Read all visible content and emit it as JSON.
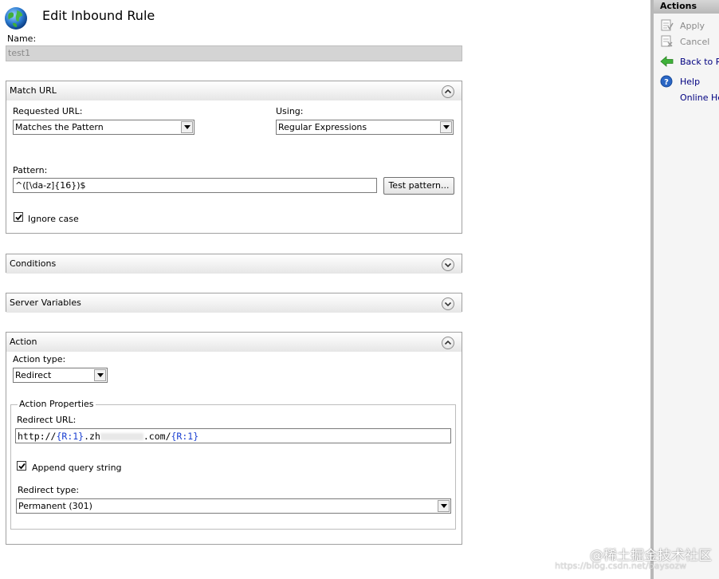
{
  "page": {
    "title": "Edit Inbound Rule",
    "name_label": "Name:",
    "name_value": "test1"
  },
  "match_url": {
    "title": "Match URL",
    "requested_url_label": "Requested URL:",
    "requested_url_value": "Matches the Pattern",
    "using_label": "Using:",
    "using_value": "Regular Expressions",
    "pattern_label": "Pattern:",
    "pattern_value": "^([\\da-z]{16})$",
    "test_pattern_button": "Test pattern...",
    "ignore_case_label": "Ignore case",
    "ignore_case_checked": true
  },
  "conditions": {
    "title": "Conditions"
  },
  "server_variables": {
    "title": "Server Variables"
  },
  "action": {
    "title": "Action",
    "action_type_label": "Action type:",
    "action_type_value": "Redirect",
    "properties_title": "Action Properties",
    "redirect_url_label": "Redirect URL:",
    "redirect_url_prefix": "http://",
    "redirect_url_token1": "{R:1}",
    "redirect_url_mid": ".zh",
    "redirect_url_domain": ".com/",
    "redirect_url_token2": "{R:1}",
    "append_query_label": "Append query string",
    "append_query_checked": true,
    "redirect_type_label": "Redirect type:",
    "redirect_type_value": "Permanent (301)"
  },
  "actions_pane": {
    "title": "Actions",
    "items": [
      {
        "label": "Apply",
        "icon": "apply-icon",
        "enabled": false
      },
      {
        "label": "Cancel",
        "icon": "cancel-icon",
        "enabled": false
      },
      {
        "label": "Back to Rul",
        "icon": "back-arrow-icon",
        "enabled": true
      },
      {
        "label": "Help",
        "icon": "help-icon",
        "enabled": true
      },
      {
        "label": "Online Help",
        "icon": "",
        "enabled": true
      }
    ]
  },
  "watermark": {
    "text": "@稀土掘金技术社区",
    "url": "https://blog.csdn.net/baysozw"
  },
  "colors": {
    "token_blue": "#1a3fd1",
    "disabled_text": "#8a8a8a",
    "name_field_bg": "#d4d4d4",
    "pane_bg": "#f5f5f5"
  }
}
